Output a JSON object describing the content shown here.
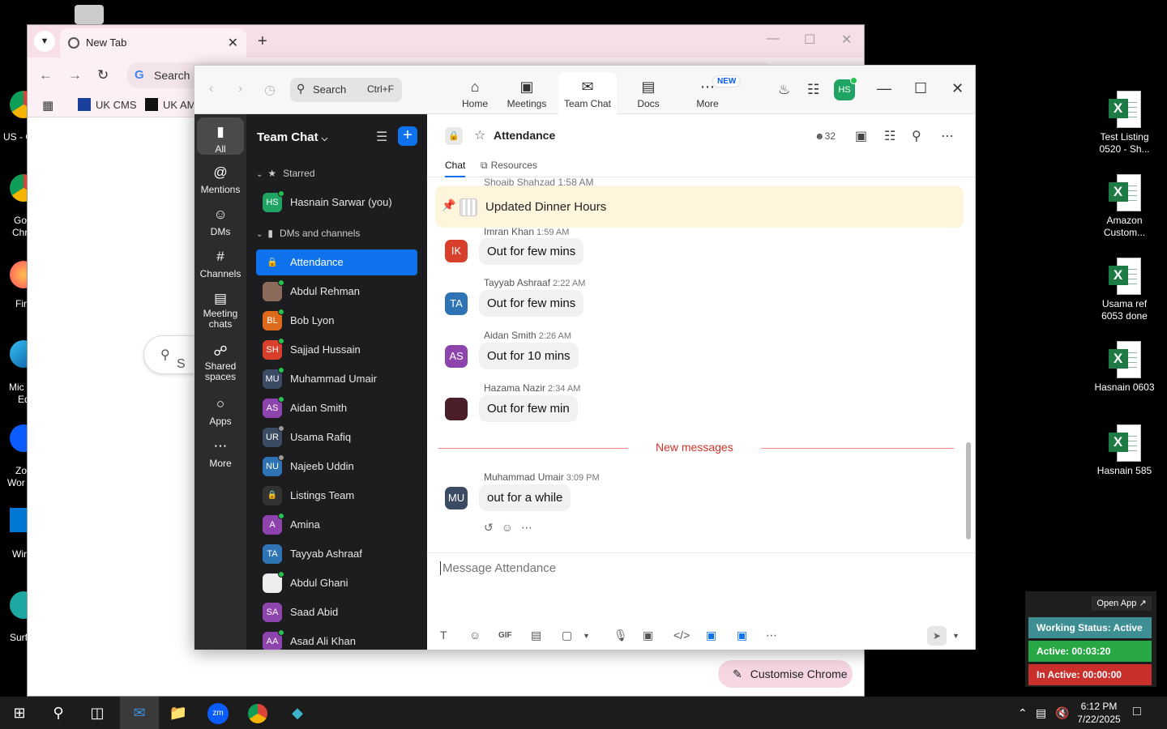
{
  "desktop": {
    "left_labels": [
      "US - C",
      "Go",
      "Chr",
      "Fir",
      "Mic",
      "Ed",
      "Zo",
      "Wor",
      "Wir",
      "Surf"
    ],
    "right_icons": [
      {
        "label_1": "Test Listing",
        "label_2": "0520 - Sh..."
      },
      {
        "label_1": "Amazon",
        "label_2": "Custom..."
      },
      {
        "label_1": "Usama ref",
        "label_2": "6053 done"
      },
      {
        "label_1": "Hasnain 0603",
        "label_2": ""
      },
      {
        "label_1": "Hasnain 585",
        "label_2": ""
      }
    ]
  },
  "chrome": {
    "tab_title": "New Tab",
    "omnibox_text": "Search C",
    "bookmarks": [
      "UK CMS",
      "UK AM"
    ],
    "search_placeholder": "S",
    "customise_label": "Customise Chrome"
  },
  "zoom": {
    "search_label": "Search",
    "search_shortcut": "Ctrl+F",
    "nav": [
      {
        "label": "Home",
        "icon": "home-icon"
      },
      {
        "label": "Meetings",
        "icon": "video-icon"
      },
      {
        "label": "Team Chat",
        "icon": "chat-icon"
      },
      {
        "label": "Docs",
        "icon": "doc-icon"
      },
      {
        "label": "More",
        "icon": "more-icon"
      }
    ],
    "new_badge": "NEW",
    "user_initials": "HS",
    "rail": [
      {
        "label": "All"
      },
      {
        "label": "Mentions"
      },
      {
        "label": "DMs"
      },
      {
        "label": "Channels"
      },
      {
        "label": "Meeting chats"
      },
      {
        "label": "Shared spaces"
      },
      {
        "label": "Apps"
      },
      {
        "label": "More"
      }
    ],
    "sidebar": {
      "title": "Team Chat",
      "starred_label": "Starred",
      "dms_label": "DMs and channels",
      "starred": [
        {
          "initials": "HS",
          "name": "Hasnain Sarwar (you)",
          "color": "#1fa463"
        }
      ],
      "items": [
        {
          "initials": "",
          "name": "Attendance",
          "color": "#0e72ed"
        },
        {
          "initials": "",
          "name": "Abdul Rehman",
          "color": "#8a6a5a"
        },
        {
          "initials": "BL",
          "name": "Bob Lyon",
          "color": "#e06a1b"
        },
        {
          "initials": "SH",
          "name": "Sajjad Hussain",
          "color": "#d9402b"
        },
        {
          "initials": "MU",
          "name": "Muhammad Umair",
          "color": "#3b4b63"
        },
        {
          "initials": "AS",
          "name": "Aidan Smith",
          "color": "#8e44ad"
        },
        {
          "initials": "UR",
          "name": "Usama Rafiq",
          "color": "#3b4b63"
        },
        {
          "initials": "NU",
          "name": "Najeeb Uddin",
          "color": "#2e74b5"
        },
        {
          "initials": "",
          "name": "Listings Team",
          "color": "#444"
        },
        {
          "initials": "A",
          "name": "Amina",
          "color": "#8e44ad"
        },
        {
          "initials": "TA",
          "name": "Tayyab Ashraaf",
          "color": "#2e74b5"
        },
        {
          "initials": "",
          "name": "Abdul Ghani",
          "color": "#eee"
        },
        {
          "initials": "SA",
          "name": "Saad Abid",
          "color": "#8e44ad"
        },
        {
          "initials": "AA",
          "name": "Asad Ali Khan",
          "color": "#8e44ad"
        }
      ]
    },
    "channel": {
      "name": "Attendance",
      "members": "32",
      "tab_chat": "Chat",
      "tab_resources": "Resources",
      "pinned": "Updated Dinner Hours",
      "cut_meta": "Shoaib Shahzad 1:58 AM",
      "messages": [
        {
          "initials": "IK",
          "author": "Imran Khan",
          "time": "1:59 AM",
          "text": "Out for few mins",
          "color": "#d9402b"
        },
        {
          "initials": "TA",
          "author": "Tayyab Ashraaf",
          "time": "2:22 AM",
          "text": "Out for few mins",
          "color": "#2e74b5"
        },
        {
          "initials": "AS",
          "author": "Aidan Smith",
          "time": "2:26 AM",
          "text": "Out for 10 mins",
          "color": "#8e44ad"
        },
        {
          "initials": "",
          "author": "Hazama Nazir",
          "time": "2:34 AM",
          "text": "Out for few min",
          "color": "#4a1f2a"
        },
        {
          "initials": "MU",
          "author": "Muhammad Umair",
          "time": "3:09 PM",
          "text": "out for a while",
          "color": "#3b4b63"
        }
      ],
      "new_messages": "New messages",
      "composer_placeholder": "Message Attendance"
    }
  },
  "taskbar": {
    "time": "6:12 PM",
    "date": "7/22/2025"
  },
  "status_widget": {
    "open_app": "Open App ↗",
    "working": "Working Status: Active",
    "active": "Active: 00:03:20",
    "inactive": "In Active: 00:00:00"
  }
}
